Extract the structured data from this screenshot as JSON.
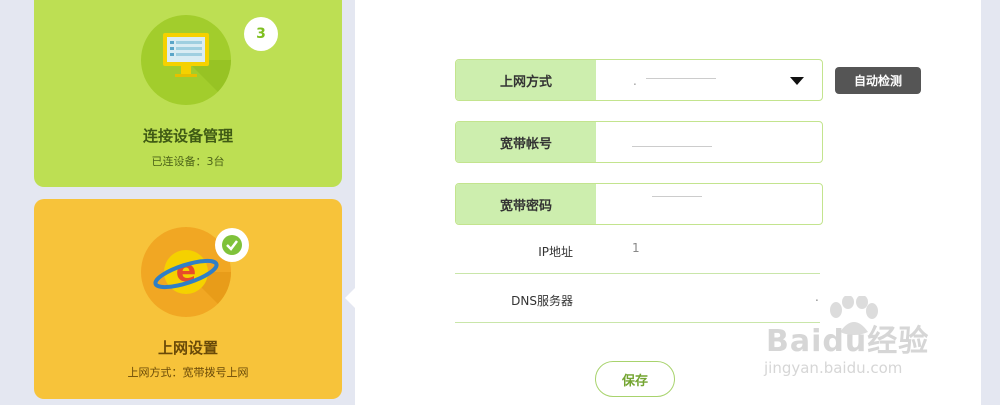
{
  "sidebar": {
    "devices": {
      "title": "连接设备管理",
      "subtitle": "已连设备：3台",
      "badge": "3",
      "icon": "monitor-icon",
      "color": "#bddf53"
    },
    "internet": {
      "title": "上网设置",
      "subtitle": "上网方式：宽带拨号上网",
      "icon": "internet-explorer-icon",
      "badge_icon": "checkmark-icon",
      "color": "#f7c33a"
    }
  },
  "form": {
    "connection_type": {
      "label": "上网方式",
      "value": "."
    },
    "auto_detect_label": "自动检测",
    "account": {
      "label": "宽带帐号"
    },
    "password": {
      "label": "宽带密码"
    },
    "ip": {
      "label": "IP地址",
      "value": "1"
    },
    "dns": {
      "label": "DNS服务器",
      "value": "."
    },
    "save_label": "保存"
  },
  "watermark": {
    "brand": "Baidu经验",
    "url": "jingyan.baidu.com"
  },
  "colors": {
    "label_bg": "#cdeeae",
    "field_border": "#c3e48e",
    "button_dark": "#555555",
    "save_text": "#74a532"
  }
}
